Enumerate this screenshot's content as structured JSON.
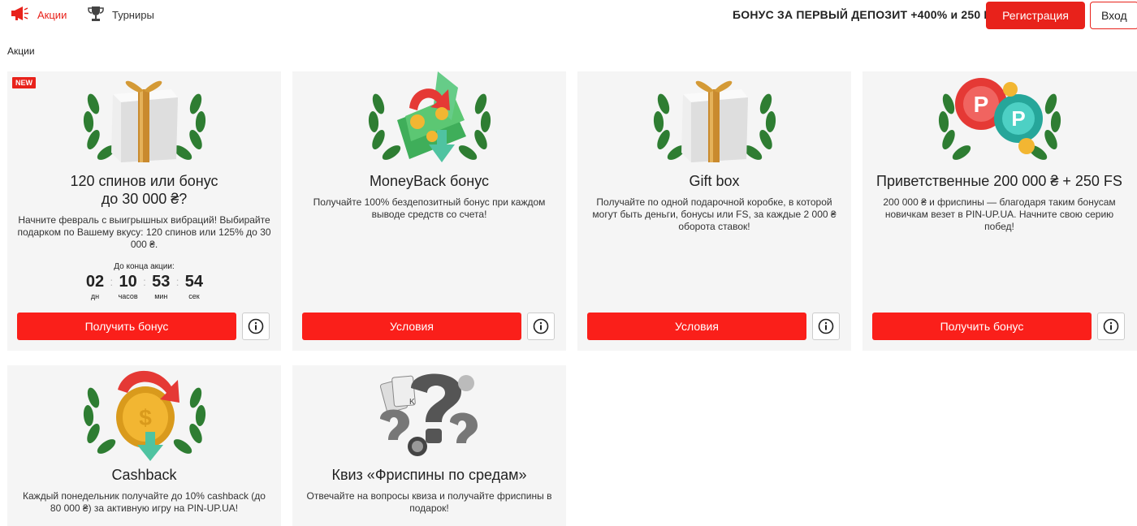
{
  "nav": {
    "promos_label": "Акции",
    "tournaments_label": "Турниры"
  },
  "header": {
    "bonus_text": "БОНУС ЗА ПЕРВЫЙ ДЕПОЗИТ +400% и 250 FS",
    "register_label": "Регистрация",
    "login_label": "Вход"
  },
  "section_title": "Акции",
  "colors": {
    "accent": "#e8221b",
    "card_bg": "#f5f5f5"
  },
  "cards": [
    {
      "badge": "NEW",
      "title_line1": "120 спинов или бонус",
      "title_line2": "до 30 000 ₴?",
      "description": "Начните февраль с выигрышных вибраций! Выбирайте подарком по Вашему вкусу: 120 спинов или 125% до 30 000 ₴.",
      "timer_label": "До конца акции:",
      "timer": [
        {
          "value": "02",
          "unit": "дн"
        },
        {
          "value": "10",
          "unit": "часов"
        },
        {
          "value": "53",
          "unit": "мин"
        },
        {
          "value": "54",
          "unit": "сек"
        }
      ],
      "cta": "Получить бонус",
      "icon": "gift-box-icon"
    },
    {
      "title": "MoneyBack бонус",
      "description": "Получайте 100% бездепозитный бонус при каждом выводе средств со счета!",
      "cta": "Условия",
      "icon": "money-back-icon"
    },
    {
      "title": "Gift box",
      "description": "Получайте по одной подарочной коробке, в которой могут быть деньги, бонусы или FS, за каждые 2 000 ₴ оборота ставок!",
      "cta": "Условия",
      "icon": "gift-box-icon"
    },
    {
      "title": "Приветственные 200 000 ₴ + 250 FS",
      "description": "200 000 ₴ и фриспины — благодаря таким бонусам новичкам везет в PIN-UP.UA. Начните свою серию побед!",
      "cta": "Получить бонус",
      "icon": "casino-chips-icon"
    },
    {
      "title": "Cashback",
      "description": "Каждый понедельник получайте до 10% cashback (до 80 000 ₴) за активную игру на PIN-UP.UA!",
      "icon": "cashback-coin-icon"
    },
    {
      "title": "Квиз «Фриспины по средам»",
      "description": "Отвечайте на вопросы квиза и получайте фриспины в подарок!",
      "icon": "quiz-question-icon"
    }
  ]
}
